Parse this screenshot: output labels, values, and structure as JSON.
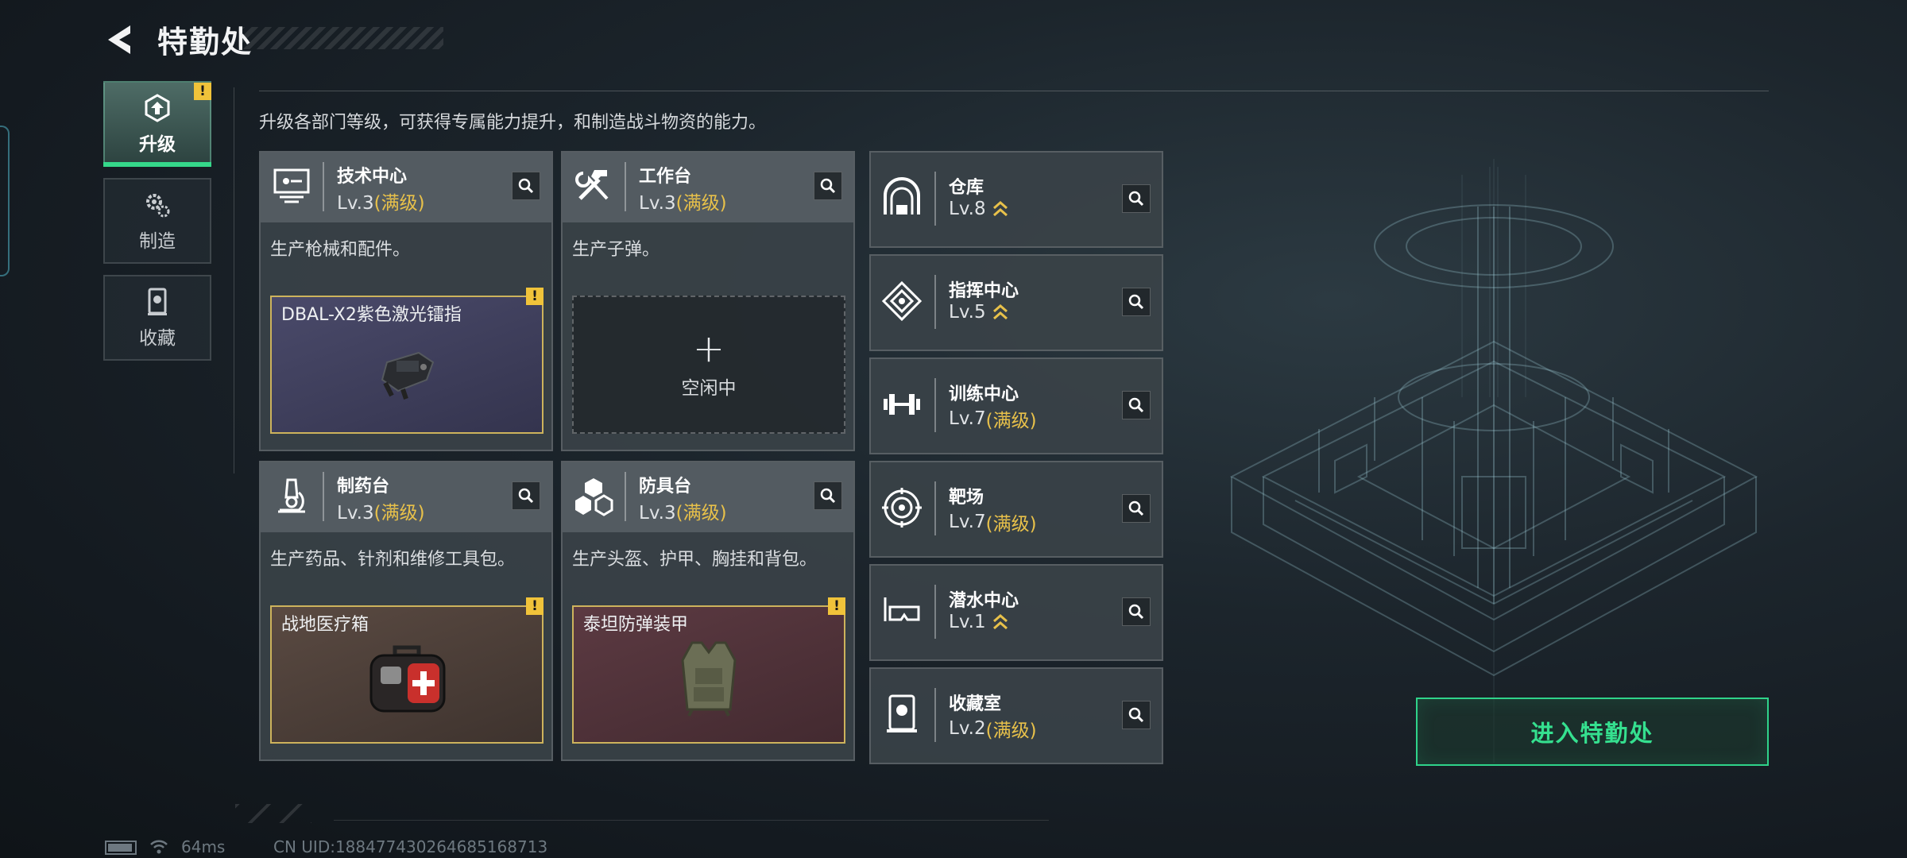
{
  "header": {
    "title": "特勤处"
  },
  "tabs": [
    {
      "label": "升级",
      "icon": "upgrade-icon",
      "active": true,
      "warning": "!"
    },
    {
      "label": "制造",
      "icon": "gears-icon",
      "active": false
    },
    {
      "label": "收藏",
      "icon": "trophy-case-icon",
      "active": false
    }
  ],
  "description": "升级各部门等级，可获得专属能力提升，和制造战斗物资的能力。",
  "maxed_label": "(满级)",
  "cards": [
    {
      "name": "技术中心",
      "level": "Lv.3",
      "desc": "生产枪械和配件。",
      "slot": {
        "name": "DBAL-X2紫色激光镭指",
        "warning": "!"
      }
    },
    {
      "name": "工作台",
      "level": "Lv.3",
      "desc": "生产子弹。",
      "slot_empty": "空闲中"
    },
    {
      "name": "制药台",
      "level": "Lv.3",
      "desc": "生产药品、针剂和维修工具包。",
      "slot": {
        "name": "战地医疗箱",
        "warning": "!"
      }
    },
    {
      "name": "防具台",
      "level": "Lv.3",
      "desc": "生产头盔、护甲、胸挂和背包。",
      "slot": {
        "name": "泰坦防弹装甲",
        "warning": "!"
      }
    }
  ],
  "facilities": [
    {
      "name": "仓库",
      "level": "Lv.8",
      "upgradable": true
    },
    {
      "name": "指挥中心",
      "level": "Lv.5",
      "upgradable": true
    },
    {
      "name": "训练中心",
      "level": "Lv.7",
      "maxed": true
    },
    {
      "name": "靶场",
      "level": "Lv.7",
      "maxed": true
    },
    {
      "name": "潜水中心",
      "level": "Lv.1",
      "upgradable": true
    },
    {
      "name": "收藏室",
      "level": "Lv.2",
      "maxed": true
    }
  ],
  "enter_button": "进入特勤处",
  "status": {
    "ping": "64ms",
    "uid": "CN UID:1884774302646851687​13"
  },
  "colors": {
    "accent_green": "#35e08f",
    "maxed_gold": "#e8c14a",
    "warning_yellow": "#f0c33a"
  }
}
